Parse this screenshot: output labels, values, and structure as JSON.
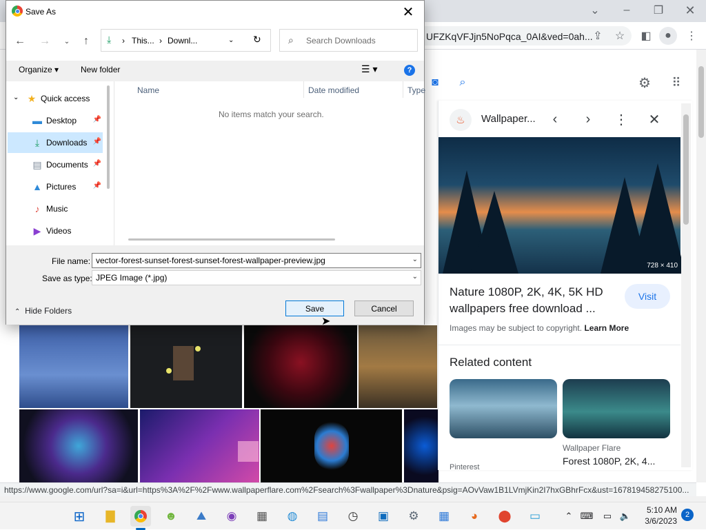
{
  "browser": {
    "url_fragment": "UFZKqVFJjn5NoPqca_0AI&ved=0ah...",
    "status_url": "https://www.google.com/url?sa=i&url=https%3A%2F%2Fwww.wallpaperflare.com%2Fsearch%3Fwallpaper%3Dnature&psig=AOvVaw1B1LVmjKin2I7hxGBhrFcx&ust=167819458275100...",
    "icons": [
      "minimize-icon",
      "restore-icon",
      "close-icon",
      "share-icon",
      "star-icon",
      "sidepanel-icon",
      "profile-icon",
      "menu-icon"
    ]
  },
  "google": {
    "icons": [
      "camera-icon",
      "search-icon",
      "settings-icon",
      "apps-icon"
    ]
  },
  "panel": {
    "site_name": "Wallpaper...",
    "image_dims": "728 × 410",
    "title": "Nature 1080P, 2K, 4K, 5K HD wallpapers free download ...",
    "visit_label": "Visit",
    "copyright_text": "Images may be subject to copyright.",
    "learn_more": "Learn More",
    "related_heading": "Related content",
    "related_source": "Wallpaper Flare",
    "related_title": "Forest 1080P, 2K, 4...",
    "related_source_left": "Pinterest"
  },
  "dialog": {
    "title": "Save As",
    "breadcrumb": [
      "This...",
      "Downl..."
    ],
    "search_placeholder": "Search Downloads",
    "organize_label": "Organize",
    "new_folder_label": "New folder",
    "tree": [
      {
        "label": "Quick access",
        "icon": "star-icon"
      },
      {
        "label": "Desktop",
        "icon": "desktop-icon"
      },
      {
        "label": "Downloads",
        "icon": "download-icon",
        "selected": true
      },
      {
        "label": "Documents",
        "icon": "document-icon"
      },
      {
        "label": "Pictures",
        "icon": "picture-icon"
      },
      {
        "label": "Music",
        "icon": "music-icon"
      },
      {
        "label": "Videos",
        "icon": "video-icon"
      }
    ],
    "columns": [
      "Name",
      "Date modified",
      "Type"
    ],
    "empty_message": "No items match your search.",
    "file_name_label": "File name:",
    "file_name_value": "vector-forest-sunset-forest-sunset-forest-wallpaper-preview.jpg",
    "save_type_label": "Save as type:",
    "save_type_value": "JPEG Image (*.jpg)",
    "hide_folders_label": "Hide Folders",
    "save_label": "Save",
    "cancel_label": "Cancel"
  },
  "taskbar": {
    "time": "5:10 AM",
    "date": "3/6/2023",
    "notification_count": "2",
    "apps": [
      "windows-start-icon",
      "file-explorer-icon",
      "chrome-icon",
      "game-icon",
      "photos-icon",
      "headphones-icon",
      "calculator-icon",
      "maps-globe-icon",
      "notepad-icon",
      "clock-icon",
      "store-icon",
      "settings-gear-icon",
      "calendar-icon",
      "firefox-icon",
      "location-pin-icon",
      "network-app-icon"
    ]
  },
  "colors": {
    "accent": "#1a73e8",
    "dialog_selection": "#cce8ff",
    "save_border": "#0078d7"
  }
}
